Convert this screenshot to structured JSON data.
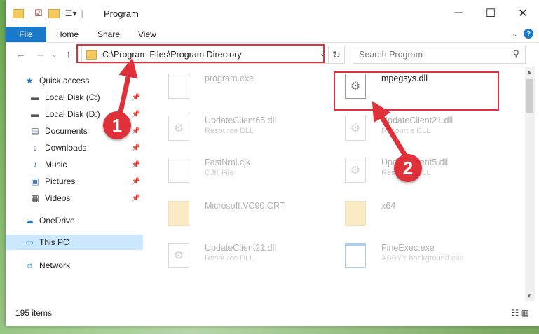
{
  "window": {
    "title": "Program"
  },
  "ribbon": {
    "file": "File",
    "home": "Home",
    "share": "Share",
    "view": "View"
  },
  "address": {
    "path": "C:\\Program Files\\Program Directory"
  },
  "search": {
    "placeholder": "Search Program"
  },
  "sidebar": {
    "items": [
      {
        "label": "Quick access",
        "icon": "star-icon"
      },
      {
        "label": "Local Disk (C:)",
        "icon": "drive-icon",
        "pinned": true
      },
      {
        "label": "Local Disk (D:)",
        "icon": "drive-icon",
        "pinned": true
      },
      {
        "label": "Documents",
        "icon": "documents-icon",
        "pinned": true
      },
      {
        "label": "Downloads",
        "icon": "downloads-icon",
        "pinned": true
      },
      {
        "label": "Music",
        "icon": "music-icon",
        "pinned": true
      },
      {
        "label": "Pictures",
        "icon": "pictures-icon",
        "pinned": true
      },
      {
        "label": "Videos",
        "icon": "videos-icon",
        "pinned": true
      },
      {
        "label": "OneDrive",
        "icon": "onedrive-icon"
      },
      {
        "label": "This PC",
        "icon": "pc-icon",
        "selected": true
      },
      {
        "label": "Network",
        "icon": "network-icon"
      }
    ]
  },
  "files": [
    {
      "name": "program.exe",
      "type": "",
      "icon": "exe-icon"
    },
    {
      "name": "mpegsys.dll",
      "type": "",
      "icon": "dll-icon"
    },
    {
      "name": "UpdateClient65.dll",
      "type": "Resource DLL",
      "icon": "dll-icon"
    },
    {
      "name": "UpdateClient21.dll",
      "type": "Resource DLL",
      "icon": "dll-icon"
    },
    {
      "name": "FastNml.cjk",
      "type": "CJK File",
      "icon": "file-icon"
    },
    {
      "name": "UpdateClient5.dll",
      "type": "Resource DLL",
      "icon": "dll-icon"
    },
    {
      "name": "Microsoft.VC90.CRT",
      "type": "",
      "icon": "folder-icon"
    },
    {
      "name": "x64",
      "type": "",
      "icon": "folder-icon"
    },
    {
      "name": "UpdateClient21.dll",
      "type": "Resource DLL",
      "icon": "dll-icon"
    },
    {
      "name": "FineExec.exe",
      "type": "ABBYY background exe",
      "icon": "exe-icon"
    }
  ],
  "status": {
    "item_count": "195 items"
  },
  "callouts": {
    "one": "1",
    "two": "2"
  },
  "colors": {
    "accent": "#1979ca",
    "highlight": "#e0313a",
    "selection": "#cce8ff"
  }
}
